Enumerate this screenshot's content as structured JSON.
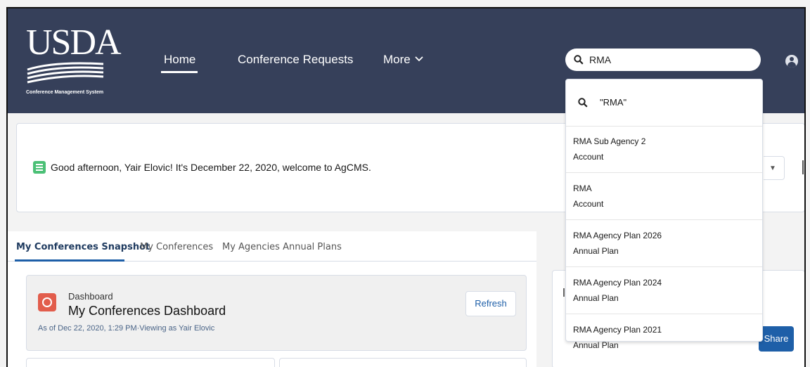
{
  "header": {
    "logo_text": "USDA",
    "logo_subtitle": "Conference Management System",
    "nav": [
      {
        "label": "Home"
      },
      {
        "label": "Conference Requests"
      },
      {
        "label": "More"
      }
    ]
  },
  "search": {
    "value": "RMA",
    "dropdown_query": "\"RMA\"",
    "results": [
      {
        "name": "RMA Sub Agency 2",
        "type": "Account"
      },
      {
        "name": "RMA",
        "type": "Account"
      },
      {
        "name": "RMA Agency Plan 2026",
        "type": "Annual Plan"
      },
      {
        "name": "RMA Agency Plan 2024",
        "type": "Annual Plan"
      },
      {
        "name": "RMA Agency Plan 2021",
        "type": "Annual Plan"
      }
    ]
  },
  "welcome": {
    "message": "Good afternoon, Yair Elovic! It's December 22, 2020, welcome to AgCMS."
  },
  "tabs": [
    {
      "label": "My Conferences Snapshot",
      "active": true
    },
    {
      "label": "My Conferences",
      "active": false
    },
    {
      "label": "My Agencies Annual Plans",
      "active": false
    }
  ],
  "dashboard": {
    "kicker": "Dashboard",
    "title": "My Conferences Dashboard",
    "meta": "As of Dec 22, 2020, 1:29 PM·Viewing as Yair Elovic",
    "refresh_label": "Refresh"
  },
  "share_label": "Share",
  "colors": {
    "header_bg": "#36405a",
    "accent_blue": "#1e5fa8",
    "welcome_icon": "#4bc076",
    "dashboard_icon": "#e25d4c"
  },
  "icons": {
    "search": "search-icon",
    "avatar": "user-avatar-icon",
    "welcome": "checklist-icon",
    "dashboard": "dashboard-icon",
    "more_chevron": "chevron-down-icon",
    "select_caret": "caret-down-icon"
  }
}
